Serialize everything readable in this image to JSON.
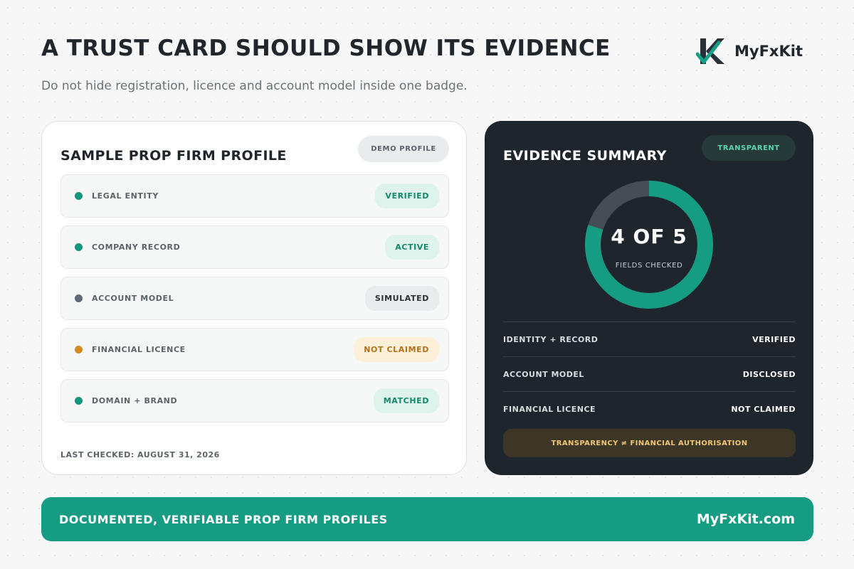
{
  "header": {
    "title": "A TRUST CARD SHOULD SHOW ITS EVIDENCE",
    "subtitle": "Do not hide registration, licence and account model inside one badge.",
    "brand_name": "MyFxKit",
    "logo_icon": "k-checkmark-logo-icon"
  },
  "profile": {
    "title": "SAMPLE PROP FIRM PROFILE",
    "tag": "DEMO PROFILE",
    "rows": [
      {
        "label": "LEGAL ENTITY",
        "status": "VERIFIED",
        "tone": "green",
        "dot_color": "#14967a"
      },
      {
        "label": "COMPANY RECORD",
        "status": "ACTIVE",
        "tone": "green",
        "dot_color": "#14967a"
      },
      {
        "label": "ACCOUNT MODEL",
        "status": "SIMULATED",
        "tone": "gray",
        "dot_color": "#5f6a78"
      },
      {
        "label": "FINANCIAL LICENCE",
        "status": "NOT CLAIMED",
        "tone": "amber",
        "dot_color": "#d38b22"
      },
      {
        "label": "DOMAIN + BRAND",
        "status": "MATCHED",
        "tone": "green",
        "dot_color": "#14967a"
      }
    ],
    "last_checked": "LAST CHECKED: AUGUST 31, 2026"
  },
  "summary": {
    "title": "EVIDENCE SUMMARY",
    "tag": "TRANSPARENT",
    "checked_text": "4 OF 5",
    "checked_caption": "FIELDS CHECKED",
    "checked_fraction": 0.8,
    "rows": [
      {
        "label": "IDENTITY + RECORD",
        "value": "VERIFIED"
      },
      {
        "label": "ACCOUNT MODEL",
        "value": "DISCLOSED"
      },
      {
        "label": "FINANCIAL LICENCE",
        "value": "NOT CLAIMED"
      }
    ],
    "note": "TRANSPARENCY ≠ FINANCIAL AUTHORISATION"
  },
  "footer": {
    "tagline": "DOCUMENTED, VERIFIABLE PROP FIRM PROFILES",
    "site": "MyFxKit.com"
  },
  "colors": {
    "accent": "#169c82",
    "dark_card": "#1f252c",
    "amber": "#d38b22"
  }
}
